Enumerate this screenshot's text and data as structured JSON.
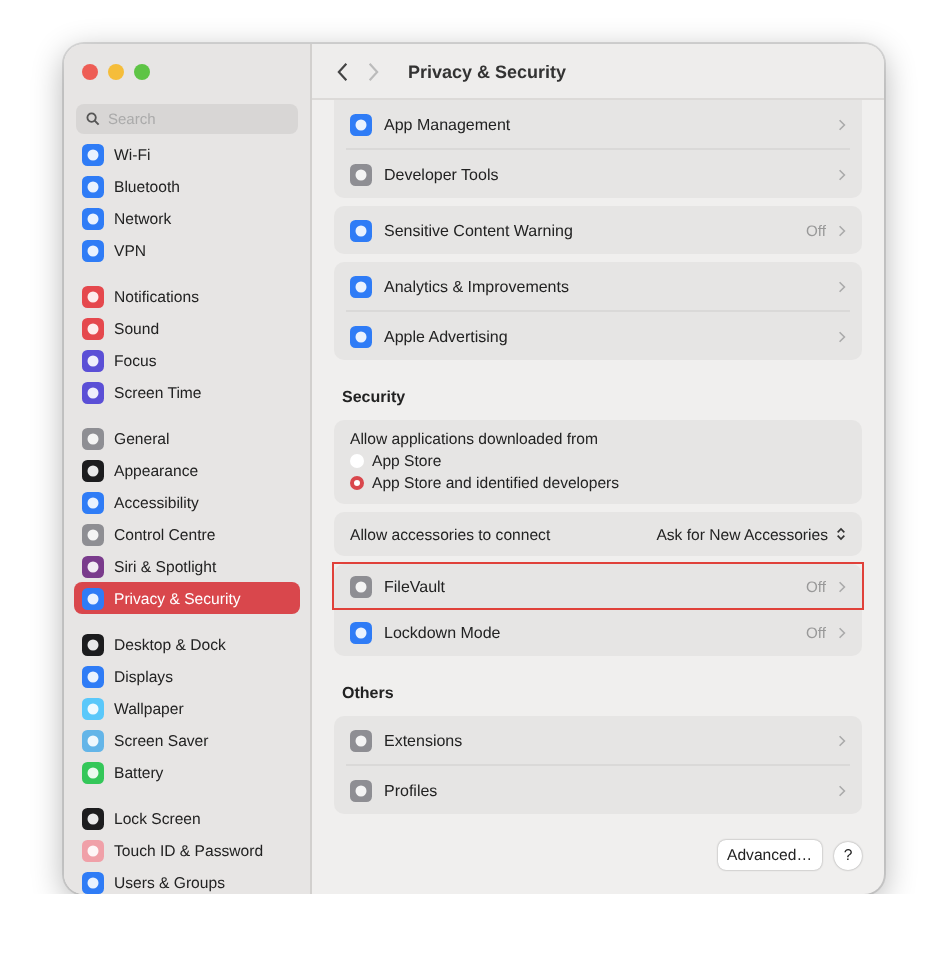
{
  "window": {
    "title": "Privacy & Security"
  },
  "sidebar": {
    "search": {
      "placeholder": "Search"
    },
    "groups": [
      [
        {
          "label": "Wi-Fi",
          "color": "#2f7cf6",
          "selected": false
        },
        {
          "label": "Bluetooth",
          "color": "#2f7cf6",
          "selected": false
        },
        {
          "label": "Network",
          "color": "#2f7cf6",
          "selected": false
        },
        {
          "label": "VPN",
          "color": "#2f7cf6",
          "selected": false
        }
      ],
      [
        {
          "label": "Notifications",
          "color": "#e5484d",
          "selected": false
        },
        {
          "label": "Sound",
          "color": "#e5484d",
          "selected": false
        },
        {
          "label": "Focus",
          "color": "#5b4fd6",
          "selected": false
        },
        {
          "label": "Screen Time",
          "color": "#5b4fd6",
          "selected": false
        }
      ],
      [
        {
          "label": "General",
          "color": "#8e8e93",
          "selected": false
        },
        {
          "label": "Appearance",
          "color": "#1c1c1e",
          "selected": false
        },
        {
          "label": "Accessibility",
          "color": "#2f7cf6",
          "selected": false
        },
        {
          "label": "Control Centre",
          "color": "#8e8e93",
          "selected": false
        },
        {
          "label": "Siri & Spotlight",
          "color": "#7a3b8c",
          "selected": false
        },
        {
          "label": "Privacy & Security",
          "color": "#2f7cf6",
          "selected": true
        }
      ],
      [
        {
          "label": "Desktop & Dock",
          "color": "#1c1c1e",
          "selected": false
        },
        {
          "label": "Displays",
          "color": "#2f7cf6",
          "selected": false
        },
        {
          "label": "Wallpaper",
          "color": "#5ac8fa",
          "selected": false
        },
        {
          "label": "Screen Saver",
          "color": "#64b5e8",
          "selected": false
        },
        {
          "label": "Battery",
          "color": "#34c759",
          "selected": false
        }
      ],
      [
        {
          "label": "Lock Screen",
          "color": "#1c1c1e",
          "selected": false
        },
        {
          "label": "Touch ID & Password",
          "color": "#f0a0a8",
          "selected": false
        },
        {
          "label": "Users & Groups",
          "color": "#2f7cf6",
          "selected": false
        }
      ]
    ]
  },
  "content": {
    "sections": [
      {
        "cards": [
          {
            "rows": [
              {
                "kind": "link",
                "label": "App Management",
                "color": "#2f7cf6",
                "highlighted": false
              },
              {
                "kind": "link",
                "label": "Developer Tools",
                "color": "#8e8e93",
                "highlighted": false
              }
            ]
          },
          {
            "rows": [
              {
                "kind": "link",
                "label": "Sensitive Content Warning",
                "value": "Off",
                "color": "#2f7cf6",
                "highlighted": false
              }
            ]
          },
          {
            "rows": [
              {
                "kind": "link",
                "label": "Analytics & Improvements",
                "color": "#2f7cf6",
                "highlighted": false
              },
              {
                "kind": "link",
                "label": "Apple Advertising",
                "color": "#2f7cf6",
                "highlighted": false
              }
            ]
          }
        ]
      },
      {
        "heading": "Security",
        "cards": [
          {
            "rows": [
              {
                "kind": "radio",
                "label": "Allow applications downloaded from",
                "options": [
                  {
                    "label": "App Store",
                    "selected": false
                  },
                  {
                    "label": "App Store and identified developers",
                    "selected": true
                  }
                ]
              }
            ]
          },
          {
            "rows": [
              {
                "kind": "popup",
                "label": "Allow accessories to connect",
                "value": "Ask for New Accessories"
              }
            ]
          },
          {
            "rows": [
              {
                "kind": "link",
                "label": "FileVault",
                "value": "Off",
                "color": "#8e8e93",
                "highlighted": true
              },
              {
                "kind": "link",
                "label": "Lockdown Mode",
                "value": "Off",
                "color": "#2f7cf6",
                "highlighted": false
              }
            ]
          }
        ]
      },
      {
        "heading": "Others",
        "cards": [
          {
            "rows": [
              {
                "kind": "link",
                "label": "Extensions",
                "color": "#8e8e93",
                "highlighted": false
              },
              {
                "kind": "link",
                "label": "Profiles",
                "color": "#8e8e93",
                "highlighted": false
              }
            ]
          }
        ]
      }
    ],
    "buttons": [
      {
        "kind": "text",
        "label": "Advanced…"
      },
      {
        "kind": "help",
        "label": "?"
      }
    ]
  }
}
